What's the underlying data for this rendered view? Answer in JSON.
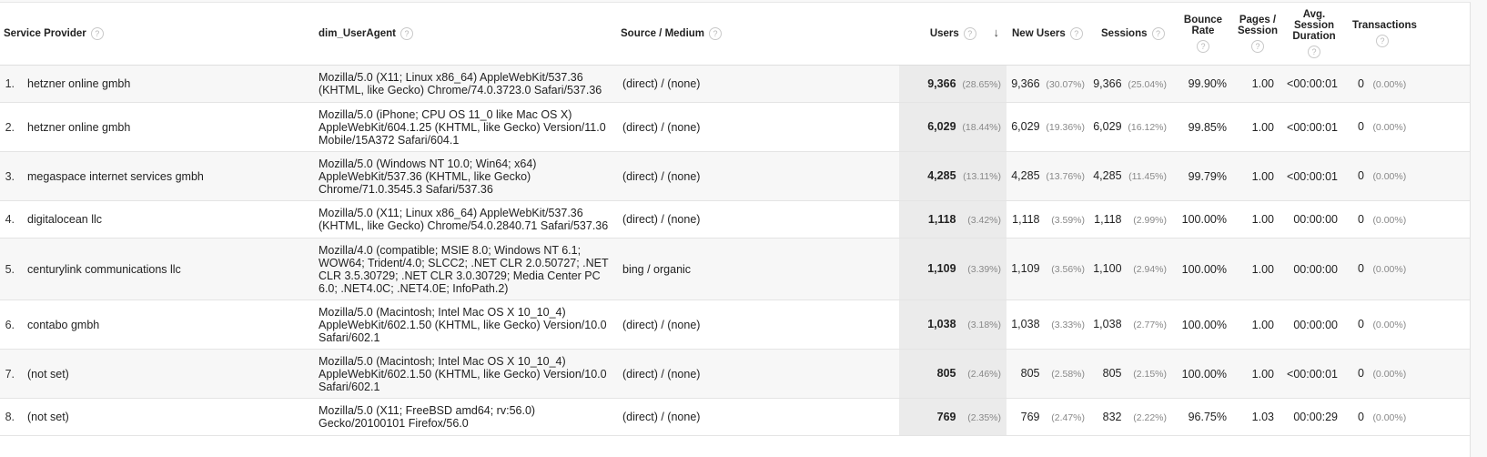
{
  "table": {
    "headers": {
      "service_provider": "Service Provider",
      "user_agent": "dim_UserAgent",
      "source_medium": "Source / Medium",
      "users": "Users",
      "new_users": "New Users",
      "sessions": "Sessions",
      "bounce_rate": [
        "Bounce",
        "Rate"
      ],
      "pages_session": [
        "Pages /",
        "Session"
      ],
      "avg_session_duration": [
        "Avg.",
        "Session",
        "Duration"
      ],
      "transactions": "Transactions"
    },
    "help_icon": "?",
    "sort_icon": "↓",
    "rows": [
      {
        "rank": "1.",
        "provider": "hetzner online gmbh",
        "user_agent": "Mozilla/5.0 (X11; Linux x86_64) AppleWebKit/537.36 (KHTML, like Gecko) Chrome/74.0.3723.0 Safari/537.36",
        "source_medium": "(direct) / (none)",
        "users": "9,366",
        "users_pct": "(28.65%)",
        "new_users": "9,366",
        "new_users_pct": "(30.07%)",
        "sessions": "9,366",
        "sessions_pct": "(25.04%)",
        "bounce_rate": "99.90%",
        "pages_session": "1.00",
        "avg_duration": "<00:00:01",
        "transactions": "0",
        "transactions_pct": "(0.00%)"
      },
      {
        "rank": "2.",
        "provider": "hetzner online gmbh",
        "user_agent": "Mozilla/5.0 (iPhone; CPU OS 11_0 like Mac OS X) AppleWebKit/604.1.25 (KHTML, like Gecko) Version/11.0 Mobile/15A372 Safari/604.1",
        "source_medium": "(direct) / (none)",
        "users": "6,029",
        "users_pct": "(18.44%)",
        "new_users": "6,029",
        "new_users_pct": "(19.36%)",
        "sessions": "6,029",
        "sessions_pct": "(16.12%)",
        "bounce_rate": "99.85%",
        "pages_session": "1.00",
        "avg_duration": "<00:00:01",
        "transactions": "0",
        "transactions_pct": "(0.00%)"
      },
      {
        "rank": "3.",
        "provider": "megaspace internet services gmbh",
        "user_agent": "Mozilla/5.0 (Windows NT 10.0; Win64; x64) AppleWebKit/537.36 (KHTML, like Gecko) Chrome/71.0.3545.3 Safari/537.36",
        "source_medium": "(direct) / (none)",
        "users": "4,285",
        "users_pct": "(13.11%)",
        "new_users": "4,285",
        "new_users_pct": "(13.76%)",
        "sessions": "4,285",
        "sessions_pct": "(11.45%)",
        "bounce_rate": "99.79%",
        "pages_session": "1.00",
        "avg_duration": "<00:00:01",
        "transactions": "0",
        "transactions_pct": "(0.00%)"
      },
      {
        "rank": "4.",
        "provider": "digitalocean llc",
        "user_agent": "Mozilla/5.0 (X11; Linux x86_64) AppleWebKit/537.36 (KHTML, like Gecko) Chrome/54.0.2840.71 Safari/537.36",
        "source_medium": "(direct) / (none)",
        "users": "1,118",
        "users_pct": "(3.42%)",
        "new_users": "1,118",
        "new_users_pct": "(3.59%)",
        "sessions": "1,118",
        "sessions_pct": "(2.99%)",
        "bounce_rate": "100.00%",
        "pages_session": "1.00",
        "avg_duration": "00:00:00",
        "transactions": "0",
        "transactions_pct": "(0.00%)"
      },
      {
        "rank": "5.",
        "provider": "centurylink communications llc",
        "user_agent": "Mozilla/4.0 (compatible; MSIE 8.0; Windows NT 6.1; WOW64; Trident/4.0; SLCC2; .NET CLR 2.0.50727; .NET CLR 3.5.30729; .NET CLR 3.0.30729; Media Center PC 6.0; .NET4.0C; .NET4.0E; InfoPath.2)",
        "source_medium": "bing / organic",
        "users": "1,109",
        "users_pct": "(3.39%)",
        "new_users": "1,109",
        "new_users_pct": "(3.56%)",
        "sessions": "1,100",
        "sessions_pct": "(2.94%)",
        "bounce_rate": "100.00%",
        "pages_session": "1.00",
        "avg_duration": "00:00:00",
        "transactions": "0",
        "transactions_pct": "(0.00%)"
      },
      {
        "rank": "6.",
        "provider": "contabo gmbh",
        "user_agent": "Mozilla/5.0 (Macintosh; Intel Mac OS X 10_10_4) AppleWebKit/602.1.50 (KHTML, like Gecko) Version/10.0 Safari/602.1",
        "source_medium": "(direct) / (none)",
        "users": "1,038",
        "users_pct": "(3.18%)",
        "new_users": "1,038",
        "new_users_pct": "(3.33%)",
        "sessions": "1,038",
        "sessions_pct": "(2.77%)",
        "bounce_rate": "100.00%",
        "pages_session": "1.00",
        "avg_duration": "00:00:00",
        "transactions": "0",
        "transactions_pct": "(0.00%)"
      },
      {
        "rank": "7.",
        "provider": "(not set)",
        "user_agent": "Mozilla/5.0 (Macintosh; Intel Mac OS X 10_10_4) AppleWebKit/602.1.50 (KHTML, like Gecko) Version/10.0 Safari/602.1",
        "source_medium": "(direct) / (none)",
        "users": "805",
        "users_pct": "(2.46%)",
        "new_users": "805",
        "new_users_pct": "(2.58%)",
        "sessions": "805",
        "sessions_pct": "(2.15%)",
        "bounce_rate": "100.00%",
        "pages_session": "1.00",
        "avg_duration": "<00:00:01",
        "transactions": "0",
        "transactions_pct": "(0.00%)"
      },
      {
        "rank": "8.",
        "provider": "(not set)",
        "user_agent": "Mozilla/5.0 (X11; FreeBSD amd64; rv:56.0) Gecko/20100101 Firefox/56.0",
        "source_medium": "(direct) / (none)",
        "users": "769",
        "users_pct": "(2.35%)",
        "new_users": "769",
        "new_users_pct": "(2.47%)",
        "sessions": "832",
        "sessions_pct": "(2.22%)",
        "bounce_rate": "96.75%",
        "pages_session": "1.03",
        "avg_duration": "00:00:29",
        "transactions": "0",
        "transactions_pct": "(0.00%)"
      }
    ]
  }
}
